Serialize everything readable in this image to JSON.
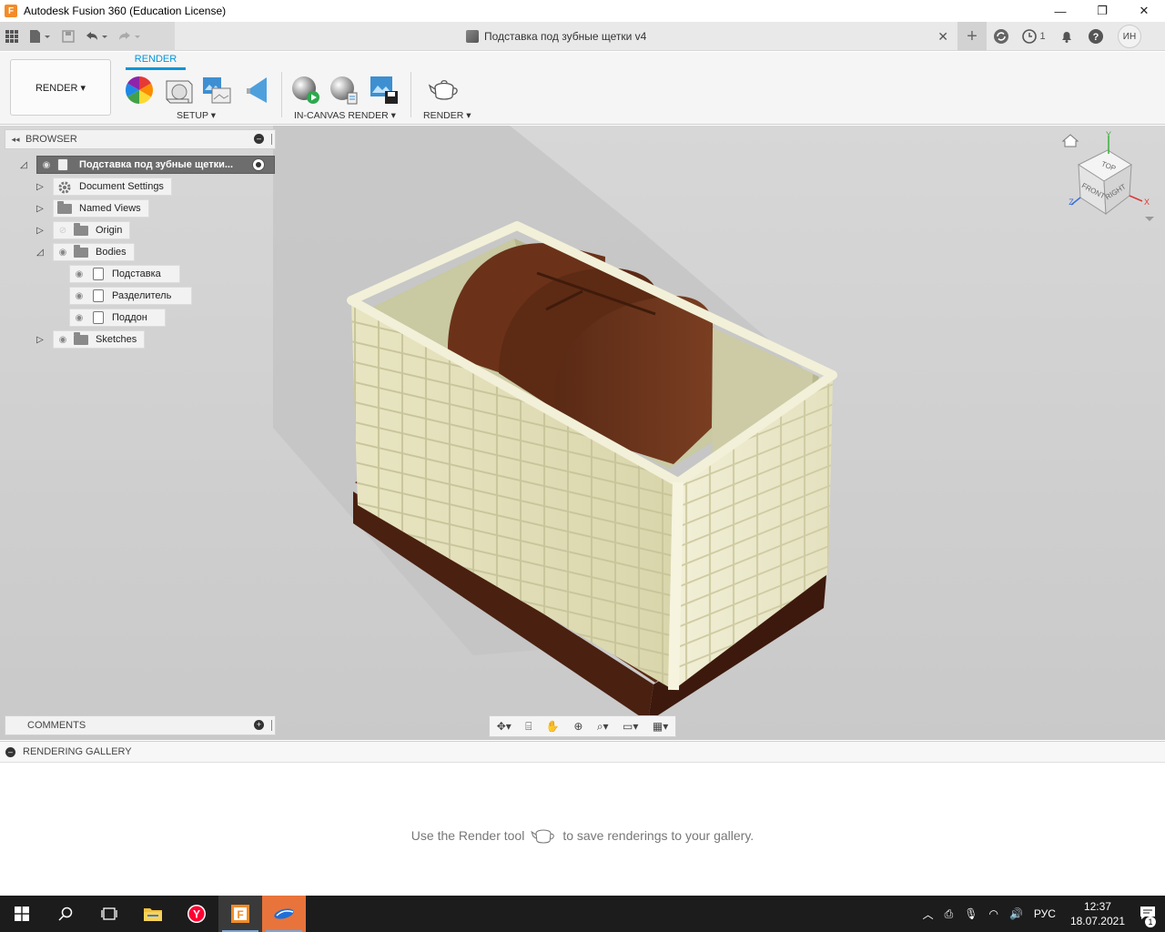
{
  "window": {
    "app_title": "Autodesk Fusion 360 (Education License)",
    "logo_letter": "F",
    "minimize": "—",
    "restore": "❐",
    "close": "✕"
  },
  "document": {
    "title": "Подставка под зубные щетки v4",
    "close": "✕",
    "job_count": "1",
    "user_initials": "ИН"
  },
  "ribbon": {
    "workspace": "RENDER ▾",
    "active_tab": "RENDER",
    "groups": {
      "setup": "SETUP ▾",
      "in_canvas": "IN-CANVAS RENDER ▾",
      "render": "RENDER ▾"
    }
  },
  "browser": {
    "title": "BROWSER",
    "root": "Подставка под зубные щетки...",
    "items": [
      {
        "label": "Document Settings"
      },
      {
        "label": "Named Views"
      },
      {
        "label": "Origin"
      },
      {
        "label": "Bodies"
      },
      {
        "label": "Подставка"
      },
      {
        "label": "Разделитель"
      },
      {
        "label": "Поддон"
      },
      {
        "label": "Sketches"
      }
    ]
  },
  "comments": {
    "title": "COMMENTS"
  },
  "viewcube": {
    "top": "TOP",
    "front": "FRONT",
    "right": "RIGHT",
    "x": "X",
    "y": "Y",
    "z": "Z"
  },
  "gallery": {
    "title": "RENDERING GALLERY",
    "msg_before": "Use the Render tool",
    "msg_after": "to save renderings to your gallery."
  },
  "taskbar": {
    "lang": "РУС",
    "time": "12:37",
    "date": "18.07.2021",
    "notif_count": "1"
  },
  "colors": {
    "accent": "#0696d7",
    "holder_body": "#e6e3bf",
    "divider": "#5c2d17",
    "tray": "#4e2412"
  }
}
